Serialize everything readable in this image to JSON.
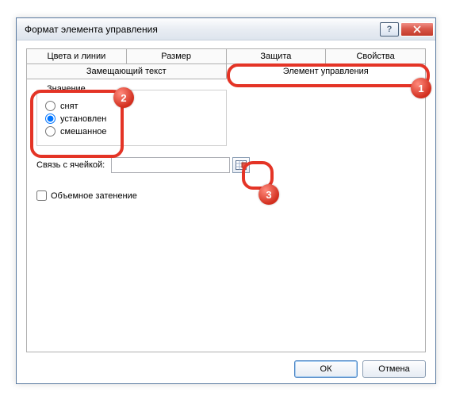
{
  "window": {
    "title": "Формат элемента управления"
  },
  "tabs": {
    "row1": [
      "Цвета и линии",
      "Размер",
      "Защита",
      "Свойства"
    ],
    "row2": [
      "Замещающий текст",
      "Элемент управления"
    ]
  },
  "group": {
    "legend": "Значение",
    "options": {
      "off": "снят",
      "on": "установлен",
      "mixed": "смешанное"
    },
    "selected": "on"
  },
  "link": {
    "label": "Связь с ячейкой:",
    "value": ""
  },
  "shadow": {
    "label": "Объемное затенение",
    "checked": false
  },
  "buttons": {
    "ok": "ОК",
    "cancel": "Отмена"
  },
  "annotations": {
    "n1": "1",
    "n2": "2",
    "n3": "3"
  }
}
